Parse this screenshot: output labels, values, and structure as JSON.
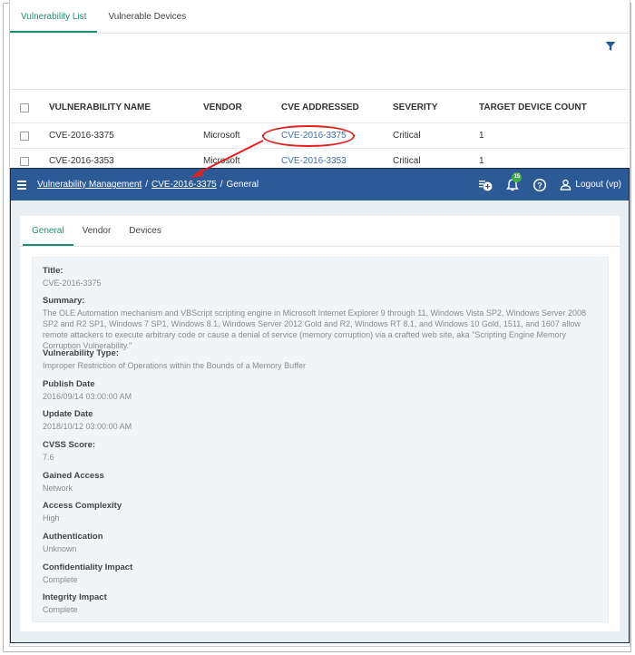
{
  "top_tabs": [
    "Vulnerability List",
    "Vulnerable Devices"
  ],
  "table": {
    "headers": [
      "VULNERABILITY NAME",
      "VENDOR",
      "CVE ADDRESSED",
      "SEVERITY",
      "TARGET DEVICE COUNT"
    ],
    "rows": [
      {
        "name": "CVE-2016-3375",
        "vendor": "Microsoft",
        "cve": "CVE-2016-3375",
        "severity": "Critical",
        "count": "1"
      },
      {
        "name": "CVE-2016-3353",
        "vendor": "Microsoft",
        "cve": "CVE-2016-3353",
        "severity": "Critical",
        "count": "1"
      }
    ]
  },
  "navbar": {
    "crumb_root": "Vulnerability Management",
    "crumb_sep1": "/",
    "crumb_cve": "CVE-2016-3375",
    "crumb_sep2": "/",
    "crumb_current": "General",
    "badge": "15",
    "logout": "Logout (vp)"
  },
  "detail_tabs": [
    "General",
    "Vendor",
    "Devices"
  ],
  "fields": [
    {
      "label": "Title:",
      "value": "CVE-2016-3375"
    },
    {
      "label": "Summary:",
      "value": "The OLE Automation mechanism and VBScript scripting engine in Microsoft Internet Explorer 9 through 11, Windows Vista SP2, Windows Server 2008 SP2 and R2 SP1, Windows 7 SP1, Windows 8.1, Windows Server 2012 Gold and R2, Windows RT 8.1, and Windows 10 Gold, 1511, and 1607 allow remote attackers to execute arbitrary code or cause a denial of service (memory corruption) via a crafted web site, aka \"Scripting Engine Memory Corruption Vulnerability.\""
    },
    {
      "label": "Vulnerability Type:",
      "value": "Improper Restriction of Operations within the Bounds of a Memory Buffer"
    },
    {
      "label": "Publish Date",
      "value": "2016/09/14 03:00:00 AM"
    },
    {
      "label": "Update Date",
      "value": "2018/10/12 03:00:00 AM"
    },
    {
      "label": "CVSS Score:",
      "value": "7.6"
    },
    {
      "label": "Gained Access",
      "value": "Network"
    },
    {
      "label": "Access Complexity",
      "value": "High"
    },
    {
      "label": "Authentication",
      "value": "Unknown"
    },
    {
      "label": "Confidentiality Impact",
      "value": "Complete"
    },
    {
      "label": "Integrity Impact",
      "value": "Complete"
    }
  ],
  "colors": {
    "accent": "#1f8f73",
    "navbar": "#2c5a97",
    "link": "#3d6fb0",
    "highlight": "#e0211e",
    "badge": "#3fae49"
  }
}
